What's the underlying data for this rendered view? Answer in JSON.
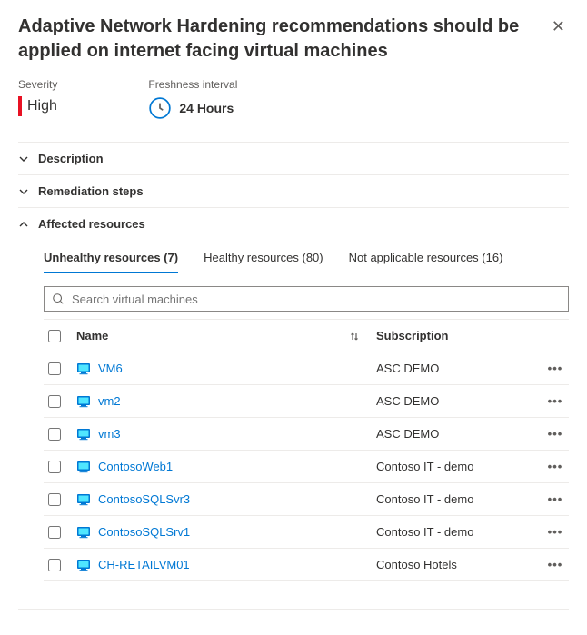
{
  "title": "Adaptive Network Hardening recommendations should be applied on internet facing virtual machines",
  "severity": {
    "label": "Severity",
    "value": "High"
  },
  "freshness": {
    "label": "Freshness interval",
    "value": "24 Hours"
  },
  "sections": {
    "description": "Description",
    "remediation": "Remediation steps",
    "affected": "Affected resources"
  },
  "tabs": {
    "unhealthy": "Unhealthy resources (7)",
    "healthy": "Healthy resources (80)",
    "na": "Not applicable resources (16)"
  },
  "search": {
    "placeholder": "Search virtual machines"
  },
  "columns": {
    "name": "Name",
    "subscription": "Subscription"
  },
  "rows": [
    {
      "name": "VM6",
      "subscription": "ASC DEMO"
    },
    {
      "name": "vm2",
      "subscription": "ASC DEMO"
    },
    {
      "name": "vm3",
      "subscription": "ASC DEMO"
    },
    {
      "name": "ContosoWeb1",
      "subscription": "Contoso IT - demo"
    },
    {
      "name": "ContosoSQLSvr3",
      "subscription": "Contoso IT - demo"
    },
    {
      "name": "ContosoSQLSrv1",
      "subscription": "Contoso IT - demo"
    },
    {
      "name": "CH-RETAILVM01",
      "subscription": "Contoso Hotels"
    }
  ]
}
